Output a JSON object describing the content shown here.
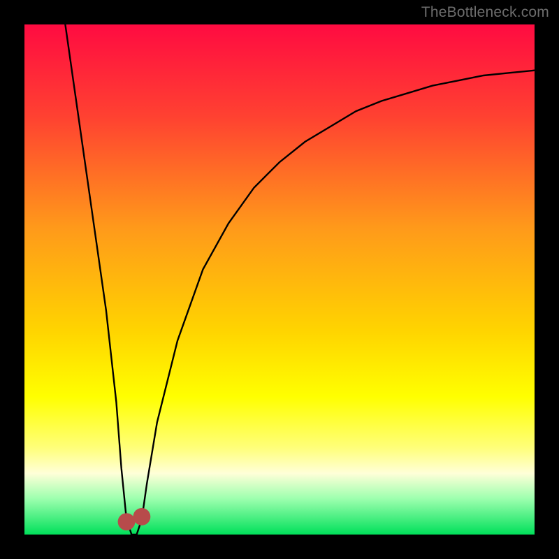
{
  "watermark": {
    "text": "TheBottleneck.com"
  },
  "chart_data": {
    "type": "line",
    "title": "",
    "xlabel": "",
    "ylabel": "",
    "xlim": [
      0,
      100
    ],
    "ylim": [
      0,
      100
    ],
    "grid": false,
    "legend": false,
    "gradient_stops": [
      {
        "offset": 0.0,
        "color": "#ff0b41"
      },
      {
        "offset": 0.18,
        "color": "#ff4131"
      },
      {
        "offset": 0.4,
        "color": "#ff9a1a"
      },
      {
        "offset": 0.6,
        "color": "#ffd400"
      },
      {
        "offset": 0.73,
        "color": "#ffff00"
      },
      {
        "offset": 0.83,
        "color": "#ffff7a"
      },
      {
        "offset": 0.88,
        "color": "#ffffd8"
      },
      {
        "offset": 0.93,
        "color": "#9cffae"
      },
      {
        "offset": 1.0,
        "color": "#00e05a"
      }
    ],
    "series": [
      {
        "name": "bottleneck-curve",
        "color": "#000000",
        "x": [
          8,
          10,
          12,
          14,
          16,
          18,
          19,
          20,
          21,
          22,
          23,
          24,
          26,
          30,
          35,
          40,
          45,
          50,
          55,
          60,
          65,
          70,
          75,
          80,
          85,
          90,
          95,
          100
        ],
        "y": [
          100,
          86,
          72,
          58,
          44,
          26,
          13,
          3,
          0,
          0,
          3,
          10,
          22,
          38,
          52,
          61,
          68,
          73,
          77,
          80,
          83,
          85,
          86.5,
          88,
          89,
          90,
          90.5,
          91
        ]
      }
    ],
    "markers": [
      {
        "name": "valley-marker",
        "x": 20,
        "y": 2.5,
        "color": "#b74b4b",
        "size": 3.4
      },
      {
        "name": "valley-marker",
        "x": 23,
        "y": 3.5,
        "color": "#b74b4b",
        "size": 3.4
      }
    ]
  }
}
